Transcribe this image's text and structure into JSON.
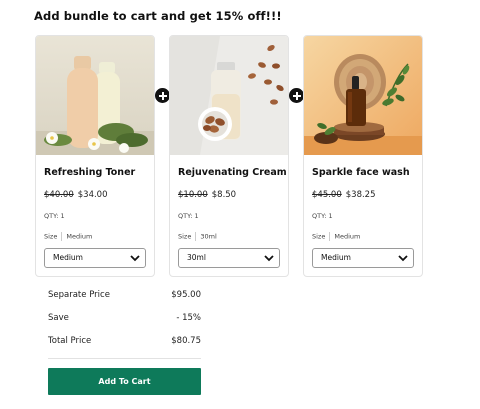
{
  "heading": "Add bundle to cart and get 15% off!!!",
  "products": [
    {
      "name": "Refreshing Toner",
      "old_price": "$40.00",
      "new_price": "$34.00",
      "qty_label": "QTY:",
      "qty_value": "1",
      "size_label": "Size",
      "size_value": "Medium",
      "selected_option": "Medium",
      "image": "toner-bottles-photo"
    },
    {
      "name": "Rejuvenating Cream",
      "old_price": "$10.00",
      "new_price": "$8.50",
      "qty_label": "QTY:",
      "qty_value": "1",
      "size_label": "Size",
      "size_value": "30ml",
      "selected_option": "30ml",
      "image": "cream-bottle-almonds-photo"
    },
    {
      "name": "Sparkle face wash",
      "old_price": "$45.00",
      "new_price": "$38.25",
      "qty_label": "QTY:",
      "qty_value": "1",
      "size_label": "Size",
      "size_value": "Medium",
      "selected_option": "Medium",
      "image": "amber-dropper-bottle-photo"
    }
  ],
  "summary": {
    "separate_price_label": "Separate Price",
    "separate_price_value": "$95.00",
    "save_label": "Save",
    "save_value": "- 15%",
    "total_label": "Total Price",
    "total_value": "$80.75"
  },
  "add_to_cart_label": "Add To Cart",
  "colors": {
    "accent": "#0e7a5a",
    "plus_badge": "#111111"
  }
}
